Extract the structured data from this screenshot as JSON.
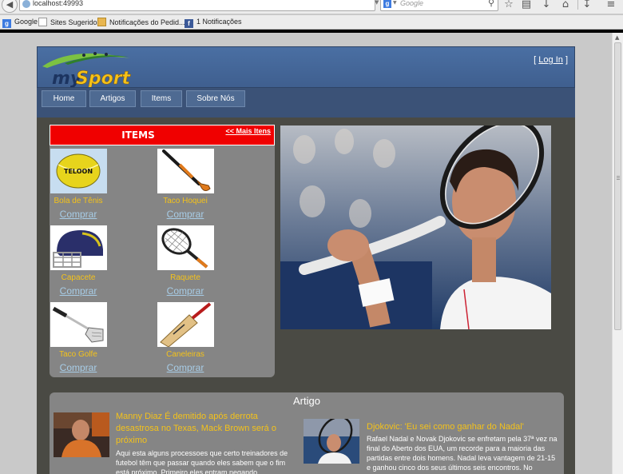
{
  "browser": {
    "url": "localhost:49993",
    "search_placeholder": "Google",
    "bookmarks": [
      "Google",
      "Sites Sugeridos",
      "Notificações do Pedid...",
      "1 Notificações"
    ]
  },
  "header": {
    "logo_text": "mySport",
    "login_open": "[",
    "login_label": "Log In",
    "login_close": "]"
  },
  "menu": [
    "Home",
    "Artigos",
    "Items",
    "Sobre Nós"
  ],
  "items_panel": {
    "title": "ITEMS",
    "more_link": "<< Mais Itens",
    "buy_label": "Comprar",
    "products": [
      {
        "name": "Bola de Tênis",
        "img_text": "TELOON"
      },
      {
        "name": "Taco Hoquei"
      },
      {
        "name": "Capacete"
      },
      {
        "name": "Raquete"
      },
      {
        "name": "Taco Golfe"
      },
      {
        "name": "Caneleiras"
      }
    ]
  },
  "artigo": {
    "title": "Artigo",
    "articles": [
      {
        "title": "Manny Diaz É demitido após derrota desastrosa no Texas, Mack Brown será o próximo",
        "text": "Aqui esta alguns processoes que certo treinadores de futebol têm que passar quando eles sabem que o fim está próximo. Primeiro eles entram negando"
      },
      {
        "title": "Djokovic: 'Eu sei como ganhar do Nadal'",
        "text": "Rafael Nadal e Novak Djokovic se enfretam pela 37ª vez na final do Aberto dos EUA, um recorde para a maioria das partidas entre dois homens. Nadal leva vantagem de 21-15 e ganhou cinco dos seus últimos seis encontros. No"
      }
    ]
  },
  "colors": {
    "accent_yellow": "#f4c21a",
    "items_header_red": "#f00000",
    "buy_link": "#a7cce6",
    "header_blue": "#4a6fa3",
    "page_bg": "#4a4a44"
  }
}
